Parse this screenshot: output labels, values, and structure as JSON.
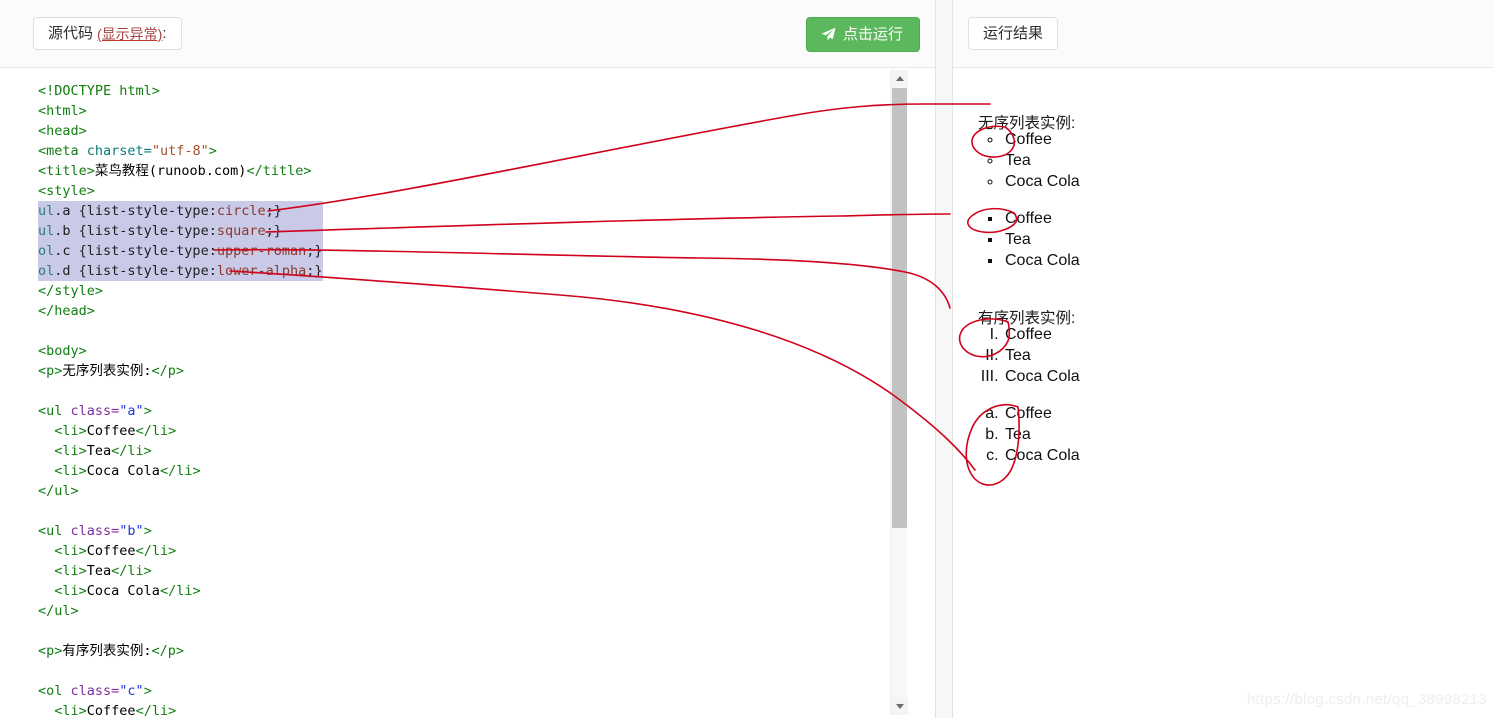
{
  "colors": {
    "run_button_bg": "#5cb85c",
    "selection_highlight": "#c9c9e8",
    "annotation_red": "#d0021b",
    "warn_text": "#a94442",
    "tag_green": "#117d11",
    "attr_purple": "#7d2fa0",
    "attr_value_blue": "#1a3ad0",
    "css_value_brown": "#8b3a2a",
    "watermark": "#eeeeee"
  },
  "left_panel": {
    "label_main": "源代码",
    "label_warn": "(显示异常)",
    "label_colon": ":",
    "run_button": {
      "label": "点击运行",
      "icon": "paper-plane-icon"
    },
    "scrollbar": {
      "up_arrow": "▲",
      "down_arrow": "▼"
    }
  },
  "right_panel": {
    "label": "运行结果",
    "heading_unordered": "无序列表实例:",
    "heading_ordered": "有序列表实例:",
    "list_circle": [
      "Coffee",
      "Tea",
      "Coca Cola"
    ],
    "list_square": [
      "Coffee",
      "Tea",
      "Coca Cola"
    ],
    "list_upper_roman": [
      "Coffee",
      "Tea",
      "Coca Cola"
    ],
    "list_lower_alpha": [
      "Coffee",
      "Tea",
      "Coca Cola"
    ]
  },
  "code": {
    "lines": [
      [
        {
          "t": "doctype",
          "s": "<!DOCTYPE html>"
        }
      ],
      [
        {
          "t": "tag",
          "s": "<html>"
        }
      ],
      [
        {
          "t": "tag",
          "s": "<head>"
        }
      ],
      [
        {
          "t": "tag",
          "s": "<meta "
        },
        {
          "t": "meta",
          "s": "charset="
        },
        {
          "t": "mval",
          "s": "\"utf-8\""
        },
        {
          "t": "tag",
          "s": ">"
        }
      ],
      [
        {
          "t": "tag",
          "s": "<title>"
        },
        {
          "t": "text",
          "s": "菜鸟教程(runoob.com)"
        },
        {
          "t": "tag",
          "s": "</title>"
        }
      ],
      [
        {
          "t": "tag",
          "s": "<style>"
        }
      ],
      [
        {
          "t": "csssel",
          "s": "ul"
        },
        {
          "t": "prop",
          "s": ".a {list-style-type:"
        },
        {
          "t": "cssv",
          "s": "circle"
        },
        {
          "t": "prop",
          "s": ";}"
        }
      ],
      [
        {
          "t": "csssel",
          "s": "ul"
        },
        {
          "t": "prop",
          "s": ".b {list-style-type:"
        },
        {
          "t": "cssv",
          "s": "square"
        },
        {
          "t": "prop",
          "s": ";}"
        }
      ],
      [
        {
          "t": "csssel",
          "s": "ol"
        },
        {
          "t": "prop",
          "s": ".c {list-style-type:"
        },
        {
          "t": "cssv",
          "s": "upper-roman"
        },
        {
          "t": "prop",
          "s": ";}"
        }
      ],
      [
        {
          "t": "csssel",
          "s": "ol"
        },
        {
          "t": "prop",
          "s": ".d {list-style-type:"
        },
        {
          "t": "cssv",
          "s": "lower-alpha"
        },
        {
          "t": "prop",
          "s": ";}"
        }
      ],
      [
        {
          "t": "tag",
          "s": "</style>"
        }
      ],
      [
        {
          "t": "tag",
          "s": "</head>"
        }
      ],
      [],
      [
        {
          "t": "tag",
          "s": "<body>"
        }
      ],
      [
        {
          "t": "tag",
          "s": "<p>"
        },
        {
          "t": "text",
          "s": "无序列表实例:"
        },
        {
          "t": "tag",
          "s": "</p>"
        }
      ],
      [],
      [
        {
          "t": "tag",
          "s": "<ul "
        },
        {
          "t": "attr",
          "s": "class="
        },
        {
          "t": "val",
          "s": "\"a\""
        },
        {
          "t": "tag",
          "s": ">"
        }
      ],
      [
        {
          "t": "plain",
          "s": "  "
        },
        {
          "t": "tag",
          "s": "<li>"
        },
        {
          "t": "text",
          "s": "Coffee"
        },
        {
          "t": "tag",
          "s": "</li>"
        }
      ],
      [
        {
          "t": "plain",
          "s": "  "
        },
        {
          "t": "tag",
          "s": "<li>"
        },
        {
          "t": "text",
          "s": "Tea"
        },
        {
          "t": "tag",
          "s": "</li>"
        }
      ],
      [
        {
          "t": "plain",
          "s": "  "
        },
        {
          "t": "tag",
          "s": "<li>"
        },
        {
          "t": "text",
          "s": "Coca Cola"
        },
        {
          "t": "tag",
          "s": "</li>"
        }
      ],
      [
        {
          "t": "tag",
          "s": "</ul>"
        }
      ],
      [],
      [
        {
          "t": "tag",
          "s": "<ul "
        },
        {
          "t": "attr",
          "s": "class="
        },
        {
          "t": "val",
          "s": "\"b\""
        },
        {
          "t": "tag",
          "s": ">"
        }
      ],
      [
        {
          "t": "plain",
          "s": "  "
        },
        {
          "t": "tag",
          "s": "<li>"
        },
        {
          "t": "text",
          "s": "Coffee"
        },
        {
          "t": "tag",
          "s": "</li>"
        }
      ],
      [
        {
          "t": "plain",
          "s": "  "
        },
        {
          "t": "tag",
          "s": "<li>"
        },
        {
          "t": "text",
          "s": "Tea"
        },
        {
          "t": "tag",
          "s": "</li>"
        }
      ],
      [
        {
          "t": "plain",
          "s": "  "
        },
        {
          "t": "tag",
          "s": "<li>"
        },
        {
          "t": "text",
          "s": "Coca Cola"
        },
        {
          "t": "tag",
          "s": "</li>"
        }
      ],
      [
        {
          "t": "tag",
          "s": "</ul>"
        }
      ],
      [],
      [
        {
          "t": "tag",
          "s": "<p>"
        },
        {
          "t": "text",
          "s": "有序列表实例:"
        },
        {
          "t": "tag",
          "s": "</p>"
        }
      ],
      [],
      [
        {
          "t": "tag",
          "s": "<ol "
        },
        {
          "t": "attr",
          "s": "class="
        },
        {
          "t": "val",
          "s": "\"c\""
        },
        {
          "t": "tag",
          "s": ">"
        }
      ],
      [
        {
          "t": "plain",
          "s": "  "
        },
        {
          "t": "tag",
          "s": "<li>"
        },
        {
          "t": "text",
          "s": "Coffee"
        },
        {
          "t": "tag",
          "s": "</li>"
        }
      ]
    ],
    "selected_line_indexes": [
      6,
      7,
      8,
      9
    ]
  },
  "watermark": "https://blog.csdn.net/qq_38998213"
}
